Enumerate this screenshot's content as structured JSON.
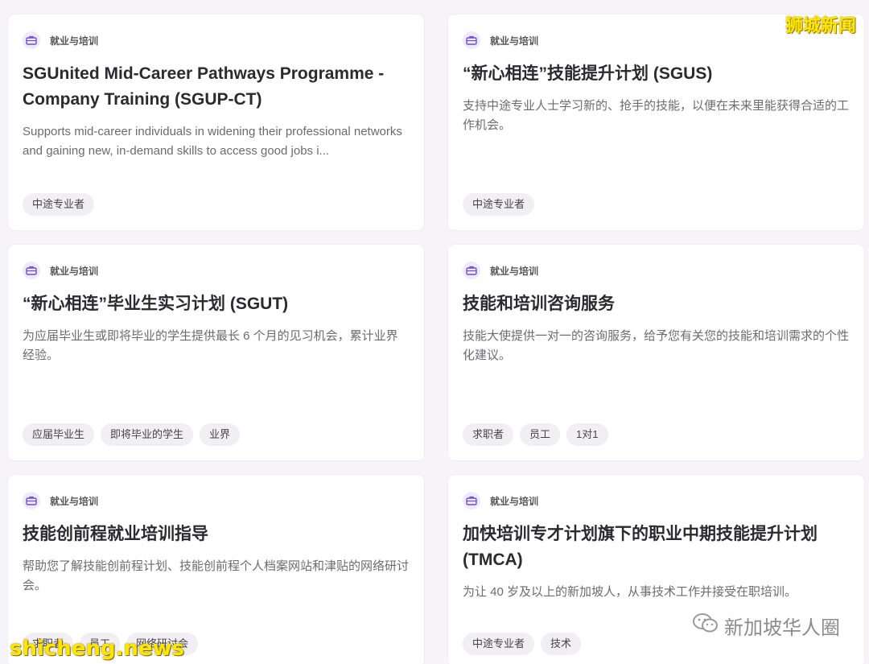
{
  "watermarks": {
    "top_right": "狮城新闻",
    "bottom_left": "shicheng.news",
    "bottom_right": "新加坡华人圈"
  },
  "cards": [
    {
      "category": "就业与培训",
      "title": "SGUnited Mid-Career Pathways Programme - Company Training (SGUP-CT)",
      "description": "Supports mid-career individuals in widening their professional networks and gaining new, in-demand skills to access good jobs i...",
      "tags": [
        "中途专业者"
      ]
    },
    {
      "category": "就业与培训",
      "title": "“新心相连”技能提升计划 (SGUS)",
      "description": "支持中途专业人士学习新的、抢手的技能，以便在未来里能获得合适的工作机会。",
      "tags": [
        "中途专业者"
      ]
    },
    {
      "category": "就业与培训",
      "title": "“新心相连”毕业生实习计划 (SGUT)",
      "description": "为应届毕业生或即将毕业的学生提供最长 6 个月的见习机会，累计业界经验。",
      "tags": [
        "应届毕业生",
        "即将毕业的学生",
        "业界"
      ]
    },
    {
      "category": "就业与培训",
      "title": "技能和培训咨询服务",
      "description": "技能大使提供一对一的咨询服务，给予您有关您的技能和培训需求的个性化建议。",
      "tags": [
        "求职者",
        "员工",
        "1对1"
      ]
    },
    {
      "category": "就业与培训",
      "title": "技能创前程就业培训指导",
      "description": "帮助您了解技能创前程计划、技能创前程个人档案网站和津贴的网络研讨会。",
      "tags": [
        "求职者",
        "员工",
        "网络研讨会"
      ]
    },
    {
      "category": "就业与培训",
      "title": "加快培训专才计划旗下的职业中期技能提升计划 (TMCA)",
      "description": "为让 40 岁及以上的新加坡人，从事技术工作并接受在职培训。",
      "tags": [
        "中途专业者",
        "技术"
      ]
    }
  ]
}
